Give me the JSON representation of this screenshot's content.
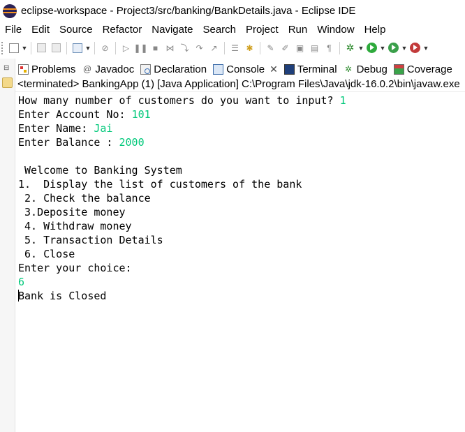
{
  "window": {
    "title": "eclipse-workspace - Project3/src/banking/BankDetails.java - Eclipse IDE"
  },
  "menubar": {
    "items": [
      "File",
      "Edit",
      "Source",
      "Refactor",
      "Navigate",
      "Search",
      "Project",
      "Run",
      "Window",
      "Help"
    ]
  },
  "tabs": [
    {
      "label": "Problems",
      "icon": "problems-icon"
    },
    {
      "label": "Javadoc",
      "icon": "javadoc-icon"
    },
    {
      "label": "Declaration",
      "icon": "declaration-icon"
    },
    {
      "label": "Console",
      "icon": "console-icon",
      "active": true
    },
    {
      "label": "Terminal",
      "icon": "terminal-icon"
    },
    {
      "label": "Debug",
      "icon": "debug-icon"
    },
    {
      "label": "Coverage",
      "icon": "coverage-icon"
    }
  ],
  "console": {
    "status": "<terminated> BankingApp (1) [Java Application] C:\\Program Files\\Java\\jdk-16.0.2\\bin\\javaw.exe",
    "lines": [
      {
        "text": "How many number of customers do you want to input? ",
        "input": "1"
      },
      {
        "text": "Enter Account No: ",
        "input": "101"
      },
      {
        "text": "Enter Name: ",
        "input": "Jai"
      },
      {
        "text": "Enter Balance : ",
        "input": "2000"
      },
      {
        "text": "",
        "input": ""
      },
      {
        "text": " Welcome to Banking System",
        "input": ""
      },
      {
        "text": "1.  Display the list of customers of the bank",
        "input": ""
      },
      {
        "text": " 2. Check the balance",
        "input": ""
      },
      {
        "text": " 3.Deposite money",
        "input": ""
      },
      {
        "text": " 4. Withdraw money",
        "input": ""
      },
      {
        "text": " 5. Transaction Details",
        "input": ""
      },
      {
        "text": " 6. Close",
        "input": ""
      },
      {
        "text": "Enter your choice:",
        "input": ""
      },
      {
        "text": "",
        "input": "6"
      },
      {
        "text": "Bank is Closed",
        "input": ""
      }
    ]
  },
  "colors": {
    "user_input": "#00c87a",
    "title_bar_bg": "#ffffff"
  }
}
